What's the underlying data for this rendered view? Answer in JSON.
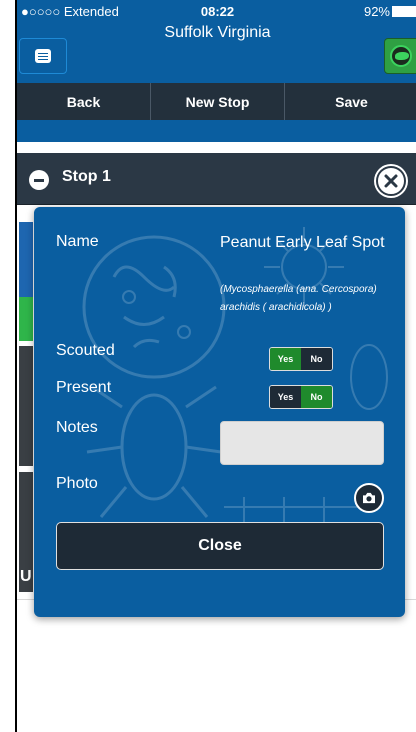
{
  "status_bar": {
    "carrier": "●○○○○ Extended",
    "time": "08:22",
    "battery": "92%"
  },
  "header": {
    "title": "Suffolk Virginia"
  },
  "toolbar": {
    "back_label": "Back",
    "new_stop_label": "New Stop",
    "save_label": "Save"
  },
  "stop": {
    "title": "Stop 1"
  },
  "background_tile_letter": "U",
  "modal": {
    "name_label": "Name",
    "pest_name": "Peanut Early Leaf Spot",
    "pest_scientific": "(Mycosphaerella (ana. Cercospora) arachidis ( arachidicola) )",
    "scouted_label": "Scouted",
    "present_label": "Present",
    "notes_label": "Notes",
    "photo_label": "Photo",
    "scouted_toggle": {
      "yes": "Yes",
      "no": "No",
      "selected": "Yes"
    },
    "present_toggle": {
      "yes": "Yes",
      "no": "No",
      "selected": "No"
    },
    "notes_value": "",
    "close_label": "Close"
  },
  "colors": {
    "brand_blue": "#0a5ea0",
    "toolbar_dark": "#23303c",
    "toggle_green": "#1f8a2c",
    "globe_green": "#2fa043"
  },
  "icons": {
    "menu": "list-menu-icon",
    "globe": "globe-icon",
    "collapse": "minus-circle-icon",
    "close": "close-circle-icon",
    "camera": "camera-icon"
  }
}
